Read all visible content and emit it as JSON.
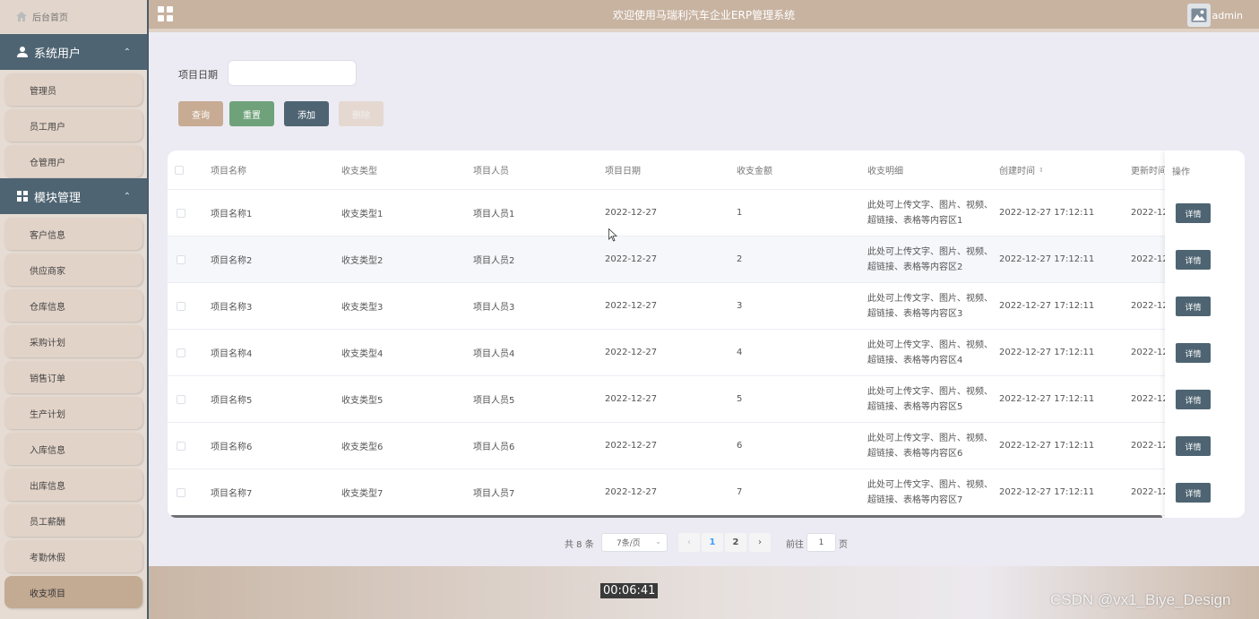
{
  "sidebar": {
    "home": "后台首页",
    "groups": [
      {
        "label": "系统用户",
        "items": [
          "管理员",
          "员工用户",
          "仓管用户"
        ]
      },
      {
        "label": "模块管理",
        "items": [
          "客户信息",
          "供应商家",
          "仓库信息",
          "采购计划",
          "销售订单",
          "生产计划",
          "入库信息",
          "出库信息",
          "员工薪酬",
          "考勤休假",
          "收支项目"
        ]
      }
    ]
  },
  "topbar": {
    "title": "欢迎使用马瑞利汽车企业ERP管理系统",
    "user": "admin"
  },
  "search": {
    "label": "项目日期",
    "value": ""
  },
  "buttons": {
    "query": "查询",
    "reset": "重置",
    "add": "添加",
    "delete": "删除"
  },
  "table": {
    "headers": [
      "项目名称",
      "收支类型",
      "项目人员",
      "项目日期",
      "收支金额",
      "收支明细",
      "创建时间",
      "更新时间",
      "操作"
    ],
    "sort_icon": "⇕",
    "detail_button": "详情",
    "rows": [
      {
        "name": "项目名称1",
        "type": "收支类型1",
        "person": "项目人员1",
        "date": "2022-12-27",
        "amount": "1",
        "detail": "此处可上传文字、图片、视频、超链接、表格等内容区1",
        "created": "2022-12-27 17:12:11",
        "updated": "2022-12"
      },
      {
        "name": "项目名称2",
        "type": "收支类型2",
        "person": "项目人员2",
        "date": "2022-12-27",
        "amount": "2",
        "detail": "此处可上传文字、图片、视频、超链接、表格等内容区2",
        "created": "2022-12-27 17:12:11",
        "updated": "2022-12"
      },
      {
        "name": "项目名称3",
        "type": "收支类型3",
        "person": "项目人员3",
        "date": "2022-12-27",
        "amount": "3",
        "detail": "此处可上传文字、图片、视频、超链接、表格等内容区3",
        "created": "2022-12-27 17:12:11",
        "updated": "2022-12"
      },
      {
        "name": "项目名称4",
        "type": "收支类型4",
        "person": "项目人员4",
        "date": "2022-12-27",
        "amount": "4",
        "detail": "此处可上传文字、图片、视频、超链接、表格等内容区4",
        "created": "2022-12-27 17:12:11",
        "updated": "2022-12"
      },
      {
        "name": "项目名称5",
        "type": "收支类型5",
        "person": "项目人员5",
        "date": "2022-12-27",
        "amount": "5",
        "detail": "此处可上传文字、图片、视频、超链接、表格等内容区5",
        "created": "2022-12-27 17:12:11",
        "updated": "2022-12"
      },
      {
        "name": "项目名称6",
        "type": "收支类型6",
        "person": "项目人员6",
        "date": "2022-12-27",
        "amount": "6",
        "detail": "此处可上传文字、图片、视频、超链接、表格等内容区6",
        "created": "2022-12-27 17:12:11",
        "updated": "2022-12"
      },
      {
        "name": "项目名称7",
        "type": "收支类型7",
        "person": "项目人员7",
        "date": "2022-12-27",
        "amount": "7",
        "detail": "此处可上传文字、图片、视频、超链接、表格等内容区7",
        "created": "2022-12-27 17:12:11",
        "updated": "2022-12"
      }
    ]
  },
  "pagination": {
    "total": "共 8 条",
    "page_size": "7条/页",
    "pages": [
      "1",
      "2"
    ],
    "current_page": "1",
    "prev": "‹",
    "next": "›",
    "goto_label": "前往",
    "goto_value": "1",
    "page_suffix": "页"
  },
  "overlay": {
    "timestamp": "00:06:41",
    "watermark": "CSDN @vx1_Biye_Design"
  },
  "colors": {
    "sidebar_group": "#4e6472",
    "topbar": "#c8b3a1",
    "btn_query": "#c7ab93",
    "btn_reset": "#6fa27a",
    "btn_add": "#4e6472",
    "active_page": "#409eff"
  }
}
